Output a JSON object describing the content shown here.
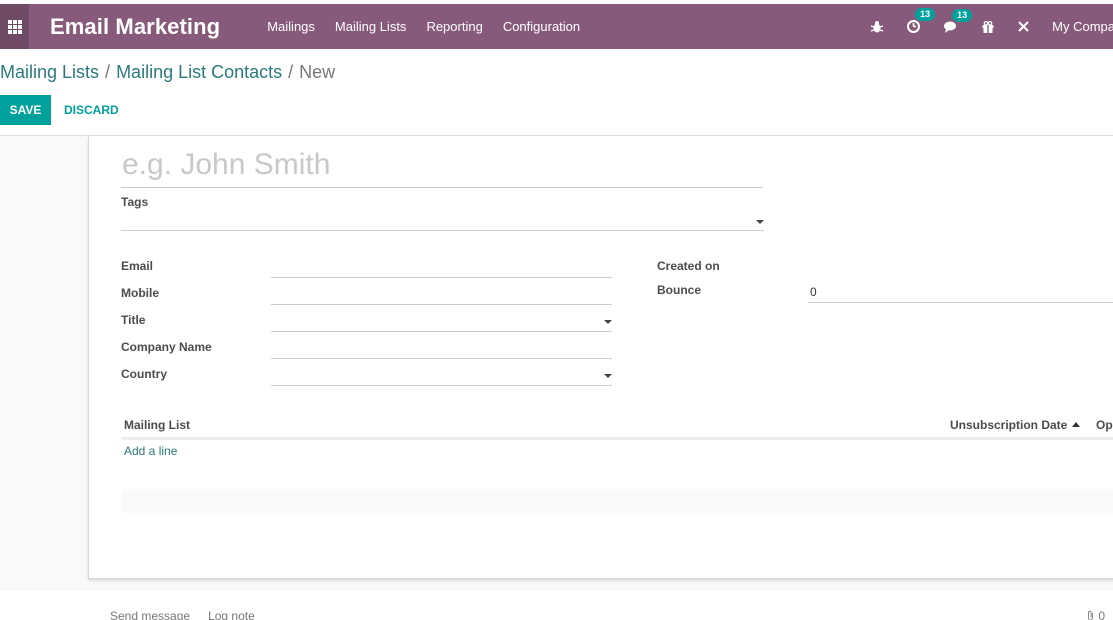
{
  "navbar": {
    "app_title": "Email Marketing",
    "menu": [
      "Mailings",
      "Mailing Lists",
      "Reporting",
      "Configuration"
    ],
    "activity_count": "13",
    "messages_count": "13",
    "company": "My Compa",
    "bg_color": "#875a7b"
  },
  "breadcrumb": {
    "items": [
      "Mailing Lists",
      "Mailing List Contacts"
    ],
    "current": "New"
  },
  "actions": {
    "save_label": "SAVE",
    "discard_label": "DISCARD",
    "accent_color": "#00a09d"
  },
  "form": {
    "name_placeholder": "e.g. John Smith",
    "tags_label": "Tags",
    "email_label": "Email",
    "mobile_label": "Mobile",
    "title_label": "Title",
    "company_name_label": "Company Name",
    "country_label": "Country",
    "created_on_label": "Created on",
    "bounce_label": "Bounce",
    "bounce_value": "0"
  },
  "mailing_table": {
    "col_mailing_list": "Mailing List",
    "col_unsub_date": "Unsubscription Date",
    "col_opt": "Op",
    "add_line": "Add a line"
  },
  "chatter": {
    "send_message": "Send message",
    "log_note": "Log note",
    "attachments": "0"
  }
}
